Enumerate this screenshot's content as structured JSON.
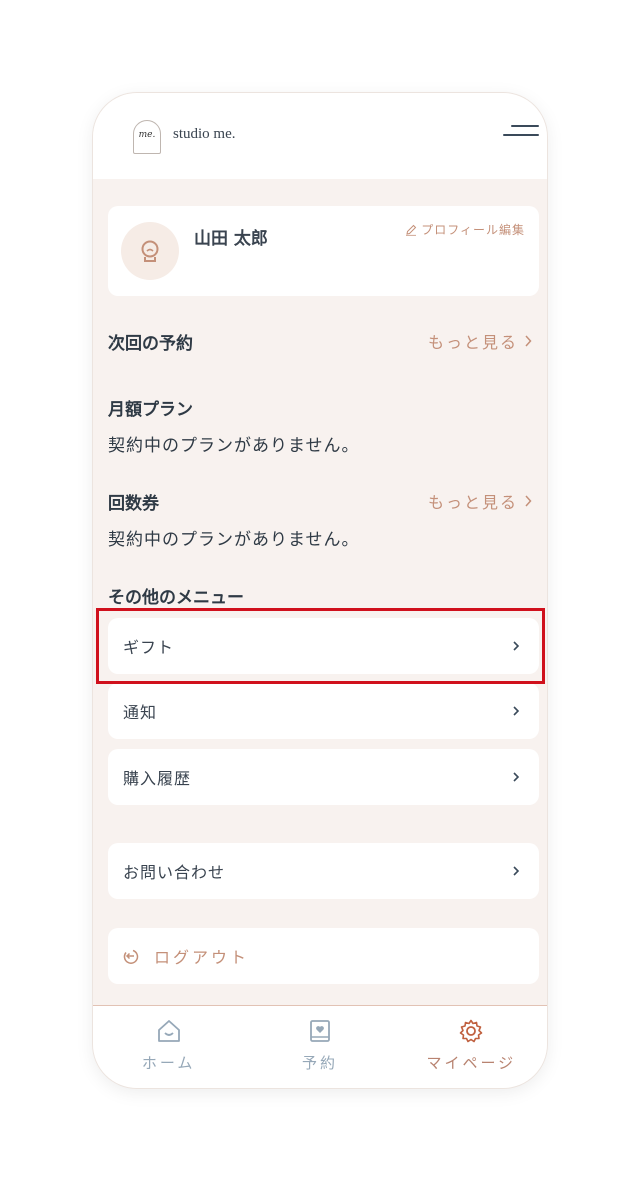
{
  "header": {
    "logo_mark": "me.",
    "brand": "studio me."
  },
  "profile": {
    "name": "山田 太郎",
    "edit_label": "プロフィール編集"
  },
  "next_reservation": {
    "title": "次回の予約",
    "more_label": "もっと見る"
  },
  "monthly_plan": {
    "title": "月額プラン",
    "status": "契約中のプランがありません。"
  },
  "tickets": {
    "title": "回数券",
    "more_label": "もっと見る",
    "status": "契約中のプランがありません。"
  },
  "other_menu": {
    "title": "その他のメニュー",
    "items": [
      {
        "label": "ギフト"
      },
      {
        "label": "通知"
      },
      {
        "label": "購入履歴"
      }
    ],
    "contact_label": "お問い合わせ",
    "logout_label": "ログアウト"
  },
  "tabbar": {
    "tabs": [
      {
        "label": "ホーム",
        "icon": "home-icon",
        "active": false
      },
      {
        "label": "予約",
        "icon": "calendar-heart-icon",
        "active": false
      },
      {
        "label": "マイページ",
        "icon": "gear-icon",
        "active": true
      }
    ]
  },
  "colors": {
    "accent": "#c49079",
    "text": "#2f3a45",
    "background": "#f8f2ef",
    "inactive": "#96a8b8",
    "highlight": "#d0101c"
  }
}
